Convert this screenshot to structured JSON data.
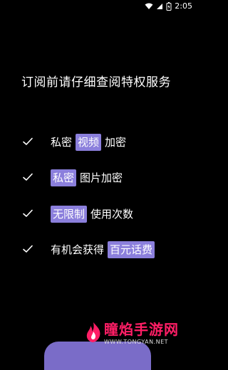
{
  "status": {
    "time": "2:05"
  },
  "headline": "订阅前请仔细查阅特权服务",
  "features": [
    {
      "pre": "私密",
      "hl": "视频",
      "post": "加密"
    },
    {
      "pre": "",
      "hl": "私密",
      "post": "图片加密"
    },
    {
      "pre": "",
      "hl": "无限制",
      "post": "使用次数"
    },
    {
      "pre": "有机会获得",
      "hl": "百元话费",
      "post": ""
    }
  ],
  "watermark": {
    "title": "瞳焰手游网",
    "url": "WWW.TONGYAN.NET"
  },
  "colors": {
    "accent": "#8b7fdc",
    "watermark": "#ff1e66"
  }
}
